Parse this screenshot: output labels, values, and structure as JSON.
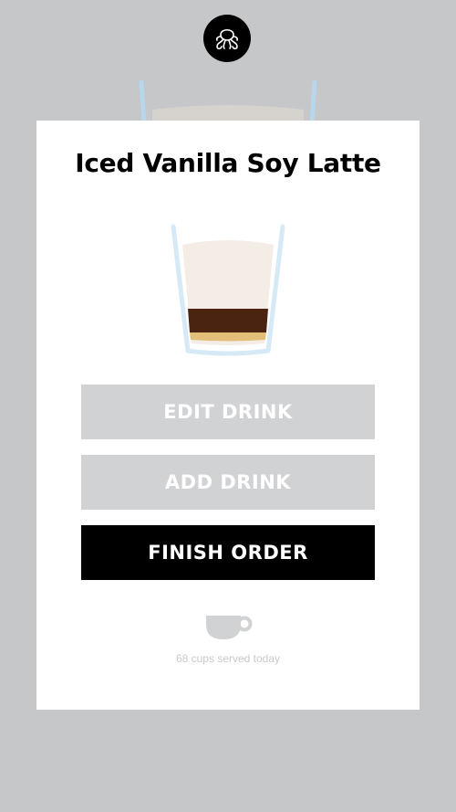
{
  "brand": {
    "logo_icon": "octopus-logo-icon"
  },
  "drink": {
    "title": "Iced Vanilla Soy Latte",
    "illustration_icon": "iced-latte-glass-icon"
  },
  "actions": {
    "edit_label": "EDIT DRINK",
    "add_label": "ADD DRINK",
    "finish_label": "FINISH ORDER"
  },
  "stats": {
    "icon": "coffee-cup-icon",
    "served_text": "68 cups served today"
  },
  "colors": {
    "background": "#c6c7c9",
    "card": "#ffffff",
    "button_disabled": "#d1d2d4",
    "button_primary": "#000000",
    "foam": "#f4ede6",
    "espresso": "#4a2410",
    "glass": "#d5e9f6"
  }
}
